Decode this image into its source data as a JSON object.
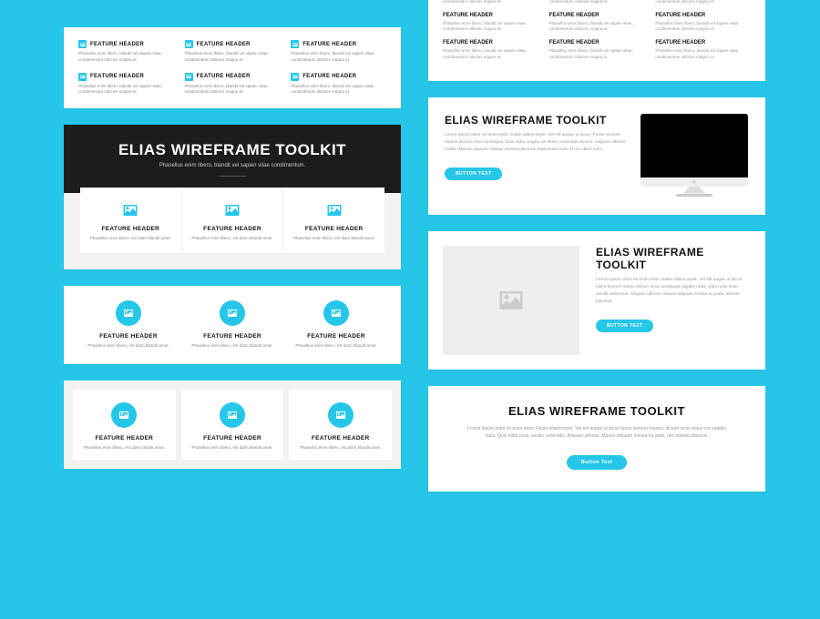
{
  "common": {
    "feature_header": "FEATURE HEADER",
    "lorem_short": "Phasellus enim libero, blandit vel sapien vitae, condimentum ultricies magna et.",
    "lorem_tiny": "Phasellus enim libero, est diam blandit amet."
  },
  "left": {
    "cardB": {
      "title": "ELIAS WIREFRAME TOOLKIT",
      "sub": "Phasellus enim libero, blandit vel sapien vitae condimentum."
    }
  },
  "right": {
    "r2": {
      "title": "ELIAS WIREFRAME TOOLKIT",
      "body": "Lorem ipsum dolor sit amet enim. Etiam ullamcorper. Vel elit augue ut lacus. Fusce semper mauris dictum urna consequat. Duis nulla magna vel libero venenatis viverra. Aliquam ultrices mattis. Mauris aliquam massa, laoreet placerat. Maecenas nunc id orci diam enim.",
      "button": "BUTTON TEXT"
    },
    "r3": {
      "title": "ELIAS WIREFRAME TOOLKIT",
      "body": "Lorem ipsum dolor sit amet enim. Etiam ullamcorper. Vel elit augue ut lacus fusce kestrel mauris dictum urna consequat sagittis nulla. Quis nulla risus iaculis venenatis. Aliquam ultrices. Mauris aliquam massa eu justo, laoreet placerat.",
      "button": "BUTTON TEXT"
    },
    "r4": {
      "title": "ELIAS WIREFRAME TOOLKIT",
      "body": "Lorem ipsum dolor sit amet enim. Etiam ullamcorper. Vel elit augue ut lacus fusce semper mauris, dictum urna neque est sagittis nulla. Quis nulla risus, iaculis venenatis. Aliquam ultrices. Mauris aliquam massa eu justo, nec laoreet placerat.",
      "button": "Button Text"
    }
  }
}
